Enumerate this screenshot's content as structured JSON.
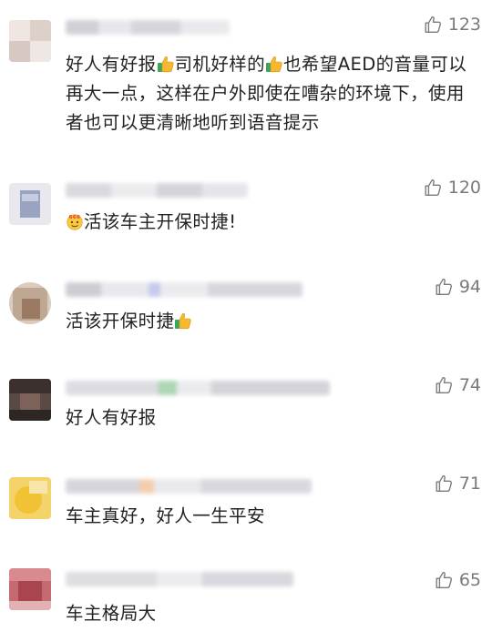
{
  "comments": [
    {
      "likes": "123",
      "text_parts": [
        "好人有好报",
        "司机好样的",
        "也希望AED的音量可以再大一点，这样在户外即使在嘈杂的环境下，使用者也可以更清晰地听到语音提示"
      ],
      "emojis": [
        "thumbs-up-emoji",
        "thumbs-up-emoji"
      ]
    },
    {
      "likes": "120",
      "text": "活该车主开保时捷!",
      "emojis": [
        "666-face-emoji"
      ]
    },
    {
      "likes": "94",
      "text": "活该开保时捷",
      "emojis": [
        "thumbs-up-emoji"
      ]
    },
    {
      "likes": "74",
      "text": "好人有好报"
    },
    {
      "likes": "71",
      "text": "车主真好，好人一生平安"
    },
    {
      "likes": "65",
      "text": "车主格局大"
    }
  ],
  "colors": {
    "text": "#222222",
    "meta": "#7a7a7a",
    "thumb_yellow": "#f5b82e",
    "thumb_green": "#3aa55c"
  }
}
